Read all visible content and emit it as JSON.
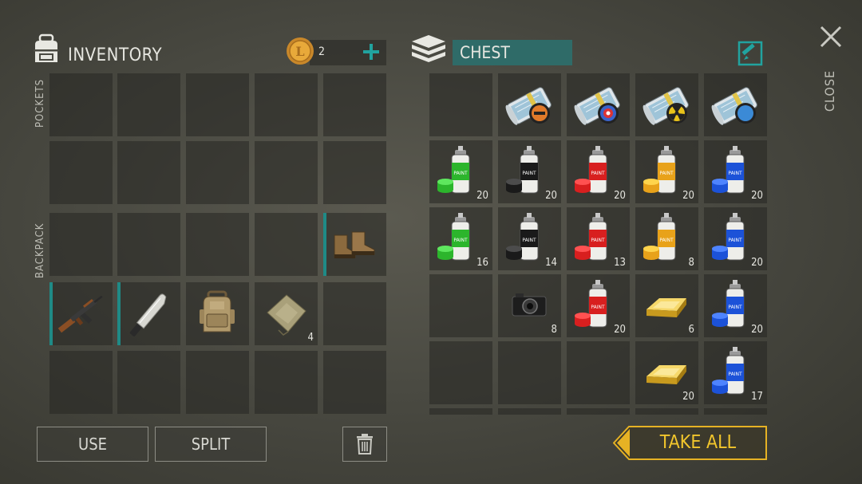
{
  "inventory": {
    "title": "INVENTORY",
    "coins": "2",
    "sections": {
      "pockets": "POCKETS",
      "backpack": "BACKPACK"
    },
    "slots": [
      {
        "row": 0,
        "col": 0,
        "item": null,
        "qty": ""
      },
      {
        "row": 0,
        "col": 1,
        "item": null,
        "qty": ""
      },
      {
        "row": 0,
        "col": 2,
        "item": null,
        "qty": ""
      },
      {
        "row": 0,
        "col": 3,
        "item": null,
        "qty": ""
      },
      {
        "row": 0,
        "col": 4,
        "item": null,
        "qty": ""
      },
      {
        "row": 1,
        "col": 0,
        "item": null,
        "qty": ""
      },
      {
        "row": 1,
        "col": 1,
        "item": null,
        "qty": ""
      },
      {
        "row": 1,
        "col": 2,
        "item": null,
        "qty": ""
      },
      {
        "row": 1,
        "col": 3,
        "item": null,
        "qty": ""
      },
      {
        "row": 1,
        "col": 4,
        "item": null,
        "qty": ""
      },
      {
        "row": 2,
        "col": 0,
        "item": null,
        "qty": ""
      },
      {
        "row": 2,
        "col": 1,
        "item": null,
        "qty": ""
      },
      {
        "row": 2,
        "col": 2,
        "item": null,
        "qty": ""
      },
      {
        "row": 2,
        "col": 3,
        "item": null,
        "qty": ""
      },
      {
        "row": 2,
        "col": 4,
        "item": "boots-icon",
        "qty": "",
        "equipped": true
      },
      {
        "row": 3,
        "col": 0,
        "item": "assault-rifle-icon",
        "qty": "",
        "equipped": true
      },
      {
        "row": 3,
        "col": 1,
        "item": "machete-icon",
        "qty": "",
        "equipped": true
      },
      {
        "row": 3,
        "col": 2,
        "item": "backpack-icon",
        "qty": ""
      },
      {
        "row": 3,
        "col": 3,
        "item": "cloth-icon",
        "qty": "4"
      },
      {
        "row": 3,
        "col": 4,
        "item": null,
        "qty": ""
      },
      {
        "row": 4,
        "col": 0,
        "item": null,
        "qty": ""
      },
      {
        "row": 4,
        "col": 1,
        "item": null,
        "qty": ""
      },
      {
        "row": 4,
        "col": 2,
        "item": null,
        "qty": ""
      },
      {
        "row": 4,
        "col": 3,
        "item": null,
        "qty": ""
      },
      {
        "row": 4,
        "col": 4,
        "item": null,
        "qty": ""
      }
    ]
  },
  "chest": {
    "title": "CHEST",
    "close_label": "CLOSE",
    "slots": [
      {
        "row": 0,
        "col": 0,
        "item": null,
        "qty": ""
      },
      {
        "row": 0,
        "col": 1,
        "item": "blueprint-orange-icon",
        "qty": ""
      },
      {
        "row": 0,
        "col": 2,
        "item": "blueprint-target-icon",
        "qty": ""
      },
      {
        "row": 0,
        "col": 3,
        "item": "blueprint-radiation-icon",
        "qty": ""
      },
      {
        "row": 0,
        "col": 4,
        "item": "blueprint-blue-icon",
        "qty": ""
      },
      {
        "row": 1,
        "col": 0,
        "item": "paint-green-icon",
        "qty": "20"
      },
      {
        "row": 1,
        "col": 1,
        "item": "paint-black-icon",
        "qty": "20"
      },
      {
        "row": 1,
        "col": 2,
        "item": "paint-red-icon",
        "qty": "20"
      },
      {
        "row": 1,
        "col": 3,
        "item": "paint-yellow-icon",
        "qty": "20"
      },
      {
        "row": 1,
        "col": 4,
        "item": "paint-blue-icon",
        "qty": "20"
      },
      {
        "row": 2,
        "col": 0,
        "item": "paint-green-icon",
        "qty": "16"
      },
      {
        "row": 2,
        "col": 1,
        "item": "paint-black-icon",
        "qty": "14"
      },
      {
        "row": 2,
        "col": 2,
        "item": "paint-red-icon",
        "qty": "13"
      },
      {
        "row": 2,
        "col": 3,
        "item": "paint-yellow-icon",
        "qty": "8"
      },
      {
        "row": 2,
        "col": 4,
        "item": "paint-blue-icon",
        "qty": "20"
      },
      {
        "row": 3,
        "col": 0,
        "item": null,
        "qty": ""
      },
      {
        "row": 3,
        "col": 1,
        "item": "camera-icon",
        "qty": "8"
      },
      {
        "row": 3,
        "col": 2,
        "item": "paint-red-icon",
        "qty": "20"
      },
      {
        "row": 3,
        "col": 3,
        "item": "gold-bar-icon",
        "qty": "6"
      },
      {
        "row": 3,
        "col": 4,
        "item": "paint-blue-icon",
        "qty": "20"
      },
      {
        "row": 4,
        "col": 0,
        "item": null,
        "qty": ""
      },
      {
        "row": 4,
        "col": 1,
        "item": null,
        "qty": ""
      },
      {
        "row": 4,
        "col": 2,
        "item": null,
        "qty": ""
      },
      {
        "row": 4,
        "col": 3,
        "item": "gold-bar-icon",
        "qty": "20"
      },
      {
        "row": 4,
        "col": 4,
        "item": "paint-blue-icon",
        "qty": "17"
      }
    ]
  },
  "buttons": {
    "use": "USE",
    "split": "SPLIT",
    "take_all": "TAKE ALL"
  },
  "colors": {
    "accent_teal": "#1f8a86",
    "take_all_gold": "#e6b224",
    "take_all_text": "#f2c62c",
    "paint_green": "#2cb52c",
    "paint_black": "#1a1a1a",
    "paint_red": "#d81f1f",
    "paint_yellow": "#e8a21a",
    "paint_blue": "#1c52d8"
  }
}
